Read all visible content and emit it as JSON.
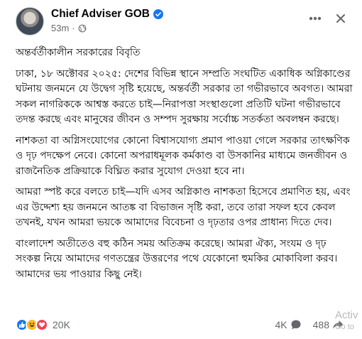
{
  "page": {
    "name": "Chief Adviser GOB",
    "time_ago": "53m",
    "dot": "·"
  },
  "post": {
    "paragraphs": [
      "অন্তর্বর্তীকালীন সরকারের বিবৃতি",
      "ঢাকা, ১৮ অক্টোবর ২০২৫: দেশের বিভিন্ন স্থানে সম্প্রতি সংঘটিত একাধিক অগ্নিকাণ্ডের ঘটনায় জনমনে যে উদ্বেগ সৃষ্টি হয়েছে, অন্তর্বর্তী সরকার তা গভীরভাবে অবগত। আমরা সকল নাগরিককে আশ্বস্ত করতে চাই—নিরাপত্তা সংস্থাগুলো প্রতিটি ঘটনা গভীরভাবে তদন্ত করছে এবং মানুষের জীবন ও সম্পদ সুরক্ষায় সর্বোচ্চ সতর্কতা অবলম্বন করছে।",
      "নাশকতা বা অগ্নিসংযোগের কোনো বিশ্বাসযোগ্য প্রমাণ পাওয়া গেলে সরকার তাৎক্ষণিক ও দৃঢ় পদক্ষেপ নেবে। কোনো অপরাধমূলক কর্মকাণ্ড বা উসকানির মাধ্যমে জনজীবন ও রাজনৈতিক প্রক্রিয়াকে বিঘ্নিত করার সুযোগ দেওয়া হবে না।",
      "আমরা স্পষ্ট করে বলতে চাই—যদি এসব অগ্নিকাণ্ড নাশকতা হিসেবে প্রমাণিত হয়, এবং এর উদ্দেশ্য হয় জনমনে আতঙ্ক বা বিভাজন সৃষ্টি করা, তবে তারা সফল হবে কেবল তখনই, যখন আমরা ভয়কে আমাদের বিবেচনা ও দৃঢ়তার ওপর প্রাধান্য দিতে দেব।",
      "বাংলাদেশ অতীতেও বহু কঠিন সময় অতিক্রম করেছে। আমরা ঐক্য, সংযম ও দৃঢ় সংকল্প নিয়ে আমাদের গণতন্ত্রের উত্তরণের পথে যেকোনো হুমকির মোকাবিলা করব। আমাদের ভয় পাওয়ার কিছু নেই।"
    ]
  },
  "footer": {
    "reaction_count": "20K",
    "comment_count": "4K",
    "share_count": "488"
  },
  "overlay": {
    "watermark_line1": "Activ",
    "watermark_line2": "Go to"
  },
  "colors": {
    "verified": "#1877f2",
    "secondary_text": "#65676b"
  },
  "icons": [
    "verified-badge-icon",
    "globe-icon",
    "more-options-icon",
    "close-icon",
    "like-reaction-icon",
    "haha-reaction-icon",
    "love-reaction-icon",
    "comment-icon",
    "share-icon"
  ]
}
